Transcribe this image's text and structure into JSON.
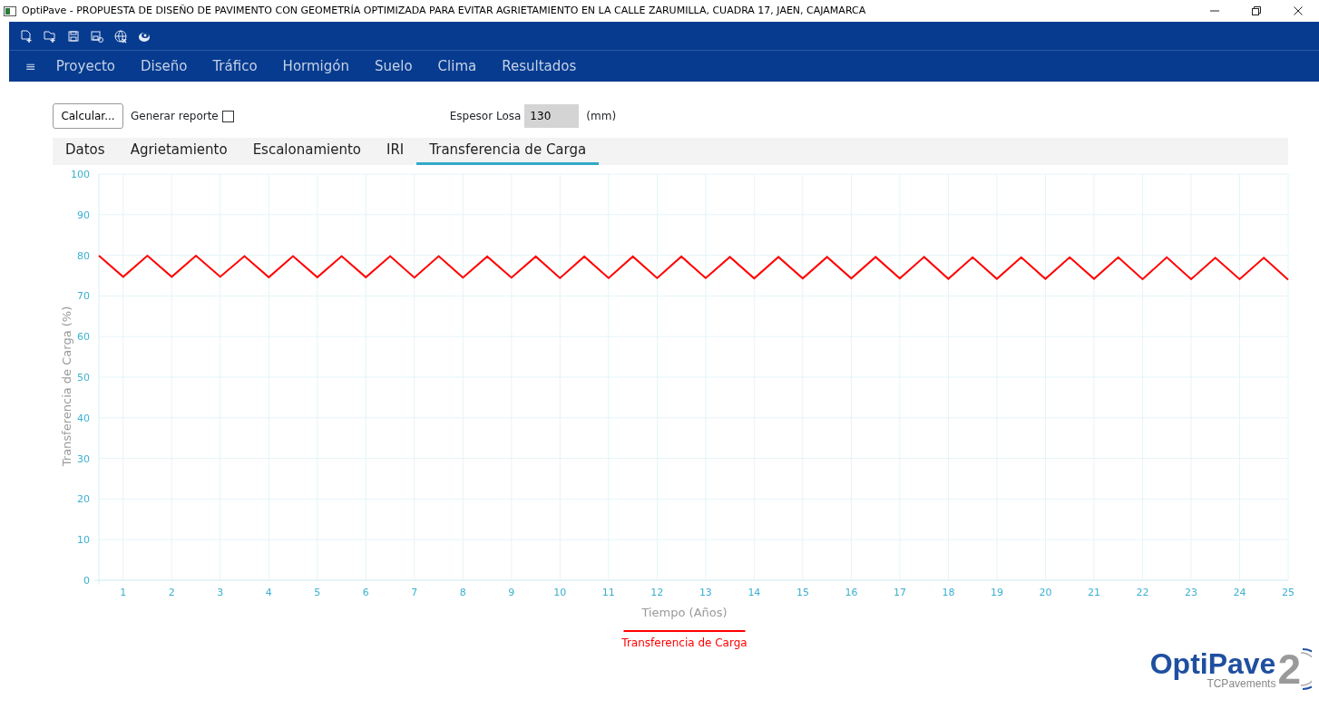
{
  "window": {
    "title": "OptiPave - PROPUESTA DE DISEÑO DE PAVIMENTO CON GEOMETRÍA OPTIMIZADA PARA EVITAR AGRIETAMIENTO EN LA CALLE ZARUMILLA, CUADRA 17, JAEN, CAJAMARCA"
  },
  "menu_icon": "≡",
  "menu": [
    {
      "label": "Proyecto",
      "selected": false
    },
    {
      "label": "Diseño",
      "selected": false
    },
    {
      "label": "Tráfico",
      "selected": false
    },
    {
      "label": "Hormigón",
      "selected": false
    },
    {
      "label": "Suelo",
      "selected": false
    },
    {
      "label": "Clima",
      "selected": false
    },
    {
      "label": "Resultados",
      "selected": false
    }
  ],
  "calculate_button": "Calcular...",
  "report_checkbox": {
    "label": "Generar reporte",
    "checked": false
  },
  "thickness": {
    "label": "Espesor Losa",
    "value": "130",
    "unit": "(mm)"
  },
  "tabs": [
    {
      "label": "Datos",
      "selected": false
    },
    {
      "label": "Agrietamiento",
      "selected": false
    },
    {
      "label": "Escalonamiento",
      "selected": false
    },
    {
      "label": "IRI",
      "selected": false
    },
    {
      "label": "Transferencia de Carga",
      "selected": true
    }
  ],
  "chart_data": {
    "type": "line",
    "xlabel": "Tiempo (Años)",
    "ylabel": "Transferencia de Carga (%)",
    "x": [
      0.5,
      1,
      1.5,
      2,
      2.5,
      3,
      3.5,
      4,
      4.5,
      5,
      5.5,
      6,
      6.5,
      7,
      7.5,
      8,
      8.5,
      9,
      9.5,
      10,
      10.5,
      11,
      11.5,
      12,
      12.5,
      13,
      13.5,
      14,
      14.5,
      15,
      15.5,
      16,
      16.5,
      17,
      17.5,
      18,
      18.5,
      19,
      19.5,
      20,
      20.5,
      21,
      21.5,
      22,
      22.5,
      23,
      23.5,
      24,
      24.5,
      25
    ],
    "series": [
      {
        "name": "Transferencia de Carga",
        "color": "#ff0000",
        "values": [
          79.9,
          74.7,
          79.9,
          74.7,
          79.9,
          74.7,
          79.8,
          74.6,
          79.8,
          74.6,
          79.8,
          74.6,
          79.8,
          74.5,
          79.8,
          74.5,
          79.7,
          74.5,
          79.7,
          74.4,
          79.7,
          74.4,
          79.7,
          74.4,
          79.7,
          74.4,
          79.6,
          74.3,
          79.6,
          74.3,
          79.6,
          74.3,
          79.6,
          74.3,
          79.6,
          74.2,
          79.5,
          74.2,
          79.5,
          74.2,
          79.5,
          74.2,
          79.5,
          74.1,
          79.5,
          74.1,
          79.4,
          74.1,
          79.4,
          74.0
        ]
      }
    ],
    "grid": true,
    "xlim": [
      0.5,
      25
    ],
    "ylim": [
      0,
      100
    ],
    "xticks": [
      1,
      2,
      3,
      4,
      5,
      6,
      7,
      8,
      9,
      10,
      11,
      12,
      13,
      14,
      15,
      16,
      17,
      18,
      19,
      20,
      21,
      22,
      23,
      24,
      25
    ],
    "yticks": [
      0,
      10,
      20,
      30,
      40,
      50,
      60,
      70,
      80,
      90,
      100
    ]
  },
  "logo": {
    "name": "OptiPave",
    "number": "2",
    "maker": "TCPavements"
  }
}
